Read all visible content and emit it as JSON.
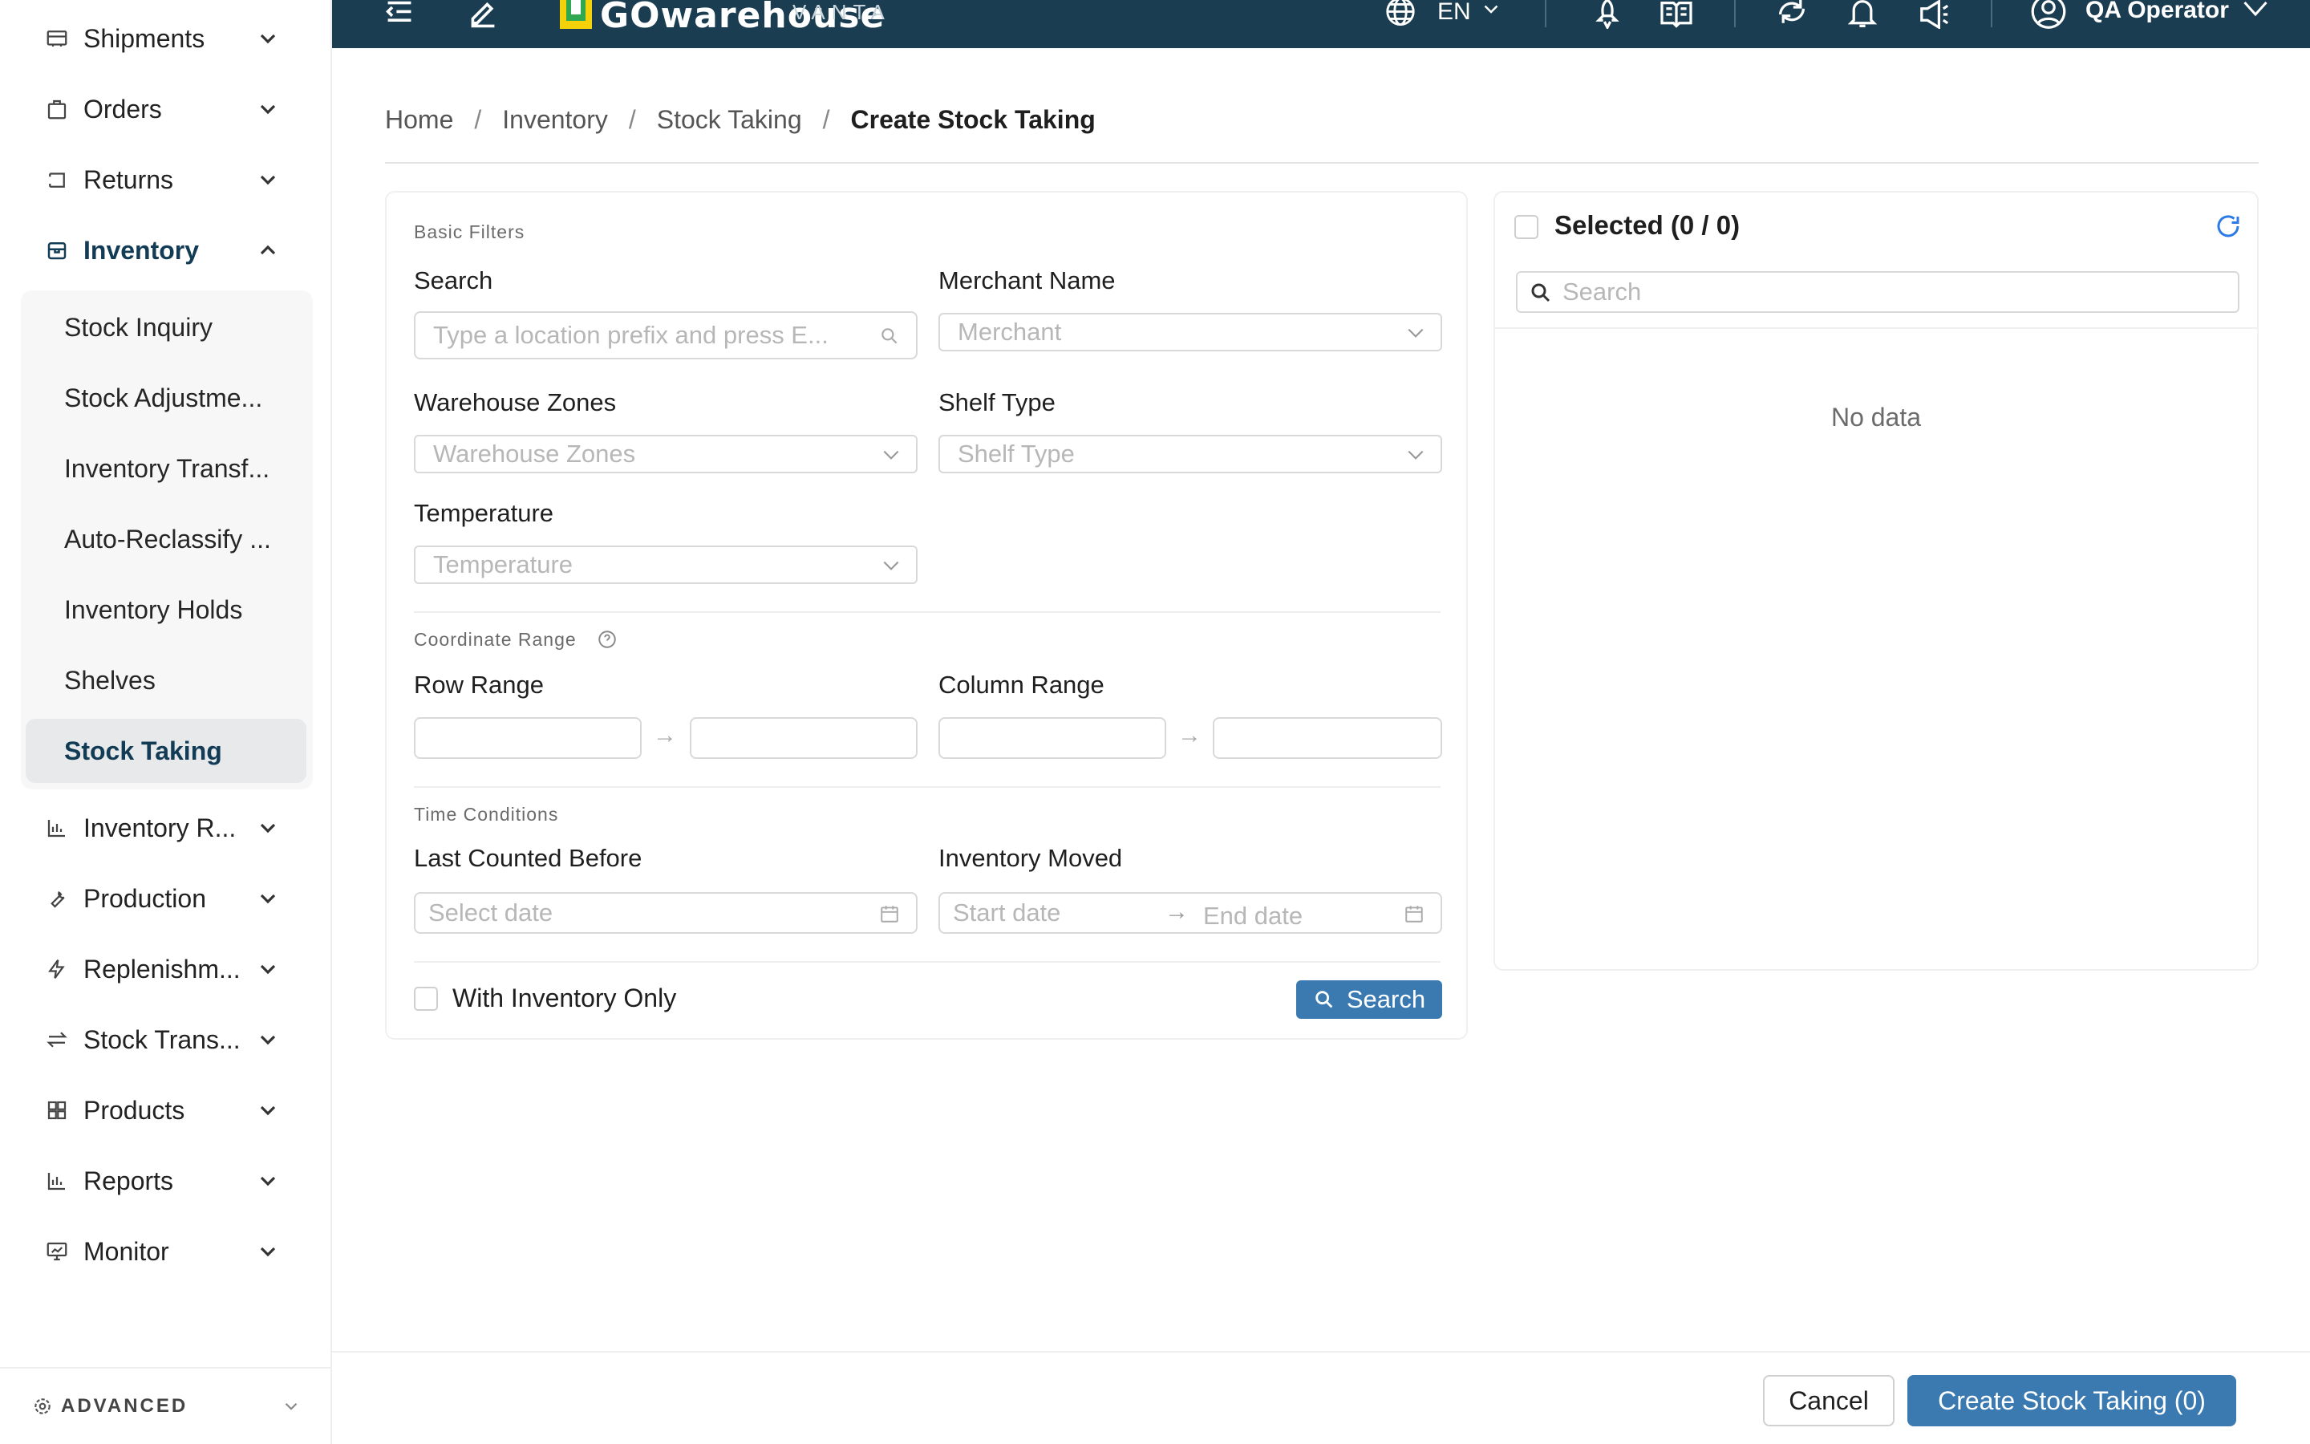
{
  "sidebar": {
    "items": [
      {
        "label": "Shipments",
        "icon": "truck-icon"
      },
      {
        "label": "Orders",
        "icon": "bag-icon"
      },
      {
        "label": "Returns",
        "icon": "return-icon"
      },
      {
        "label": "Inventory",
        "icon": "box-icon",
        "expanded": true
      },
      {
        "label": "Inventory R...",
        "icon": "bar-chart-icon"
      },
      {
        "label": "Production",
        "icon": "wrench-icon"
      },
      {
        "label": "Replenishm...",
        "icon": "lightning-icon"
      },
      {
        "label": "Stock Trans...",
        "icon": "transfer-icon"
      },
      {
        "label": "Products",
        "icon": "grid-icon"
      },
      {
        "label": "Reports",
        "icon": "bar-chart-icon"
      },
      {
        "label": "Monitor",
        "icon": "monitor-icon"
      }
    ],
    "submenu": [
      "Stock Inquiry",
      "Stock Adjustme...",
      "Inventory Transf...",
      "Auto-Reclassify ...",
      "Inventory Holds",
      "Shelves",
      "Stock Taking"
    ],
    "advanced_label": "ADVANCED"
  },
  "header": {
    "logo_text": "GOwarehouse",
    "logo_sub": "VANTA",
    "language": "EN",
    "user": "QA Operator",
    "colors": {
      "bar": "#1b3d52",
      "accent": "#3a7ab0"
    }
  },
  "breadcrumb": {
    "items": [
      "Home",
      "Inventory",
      "Stock Taking"
    ],
    "current": "Create Stock Taking",
    "separator": "/"
  },
  "filters": {
    "basic_title": "Basic Filters",
    "search_label": "Search",
    "search_placeholder": "Type a location prefix and press E...",
    "merchant_label": "Merchant Name",
    "merchant_placeholder": "Merchant",
    "zones_label": "Warehouse Zones",
    "zones_placeholder": "Warehouse Zones",
    "shelf_label": "Shelf Type",
    "shelf_placeholder": "Shelf Type",
    "temp_label": "Temperature",
    "temp_placeholder": "Temperature",
    "coord_title": "Coordinate Range",
    "row_label": "Row Range",
    "col_label": "Column Range",
    "time_title": "Time Conditions",
    "last_counted_label": "Last Counted Before",
    "last_counted_placeholder": "Select date",
    "moved_label": "Inventory Moved",
    "start_placeholder": "Start date",
    "end_placeholder": "End date",
    "with_inventory_label": "With Inventory Only",
    "search_button": "Search"
  },
  "selected": {
    "title": "Selected (0 / 0)",
    "search_placeholder": "Search",
    "empty_text": "No data"
  },
  "footer": {
    "cancel": "Cancel",
    "create": "Create Stock Taking (0)"
  }
}
